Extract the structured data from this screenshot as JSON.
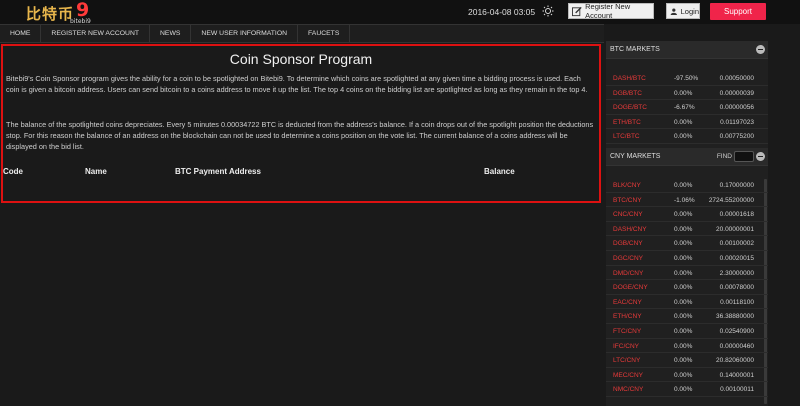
{
  "header": {
    "logo_cn": "比特币",
    "logo_9": "9",
    "logo_sub": "bitebi9",
    "datetime": "2016-04-08 03:05",
    "register_label": "Register New Account",
    "login_label": "Login",
    "support_label": "Support"
  },
  "nav": {
    "items": [
      "HOME",
      "REGISTER NEW ACCOUNT",
      "NEWS",
      "NEW USER INFORMATION",
      "FAUCETS"
    ]
  },
  "main": {
    "title": "Coin Sponsor Program",
    "p1": "Bitebi9's Coin Sponsor program gives the ability for a coin to be spotlighted on Bitebi9. To determine which coins are spotlighted at any given time a bidding process is used. Each coin is given a bitcoin address. Users can send bitcoin to a coins address to move it up the list. The top 4 coins on the bidding list are spotlighted as long as they remain in the top 4.",
    "p2": "The balance of the spotlighted coins depreciates. Every 5 minutes 0.00034722 BTC is deducted from the address's balance. If a coin drops out of the spotlight position the deductions stop. For this reason the balance of an address on the blockchain can not be used to determine a coins position on the vote list. The current balance of a coins address will be displayed on the bid list.",
    "columns": [
      "Code",
      "Name",
      "BTC Payment Address",
      "Balance"
    ]
  },
  "btc_markets": {
    "title": "BTC MARKETS",
    "rows": [
      {
        "name": "DASH/BTC",
        "change": "-97.50%",
        "price": "0.00050000"
      },
      {
        "name": "DGB/BTC",
        "change": "0.00%",
        "price": "0.00000039"
      },
      {
        "name": "DOGE/BTC",
        "change": "-6.67%",
        "price": "0.00000056"
      },
      {
        "name": "ETH/BTC",
        "change": "0.00%",
        "price": "0.01197023"
      },
      {
        "name": "LTC/BTC",
        "change": "0.00%",
        "price": "0.00775200"
      }
    ]
  },
  "cny_markets": {
    "title": "CNY MARKETS",
    "find_label": "FIND",
    "rows": [
      {
        "name": "BLK/CNY",
        "change": "0.00%",
        "price": "0.17000000"
      },
      {
        "name": "BTC/CNY",
        "change": "-1.06%",
        "price": "2724.55200000"
      },
      {
        "name": "CNC/CNY",
        "change": "0.00%",
        "price": "0.00001618"
      },
      {
        "name": "DASH/CNY",
        "change": "0.00%",
        "price": "20.00000001"
      },
      {
        "name": "DGB/CNY",
        "change": "0.00%",
        "price": "0.00100002"
      },
      {
        "name": "DGC/CNY",
        "change": "0.00%",
        "price": "0.00020015"
      },
      {
        "name": "DMD/CNY",
        "change": "0.00%",
        "price": "2.30000000"
      },
      {
        "name": "DOGE/CNY",
        "change": "0.00%",
        "price": "0.00078000"
      },
      {
        "name": "EAC/CNY",
        "change": "0.00%",
        "price": "0.00118100"
      },
      {
        "name": "ETH/CNY",
        "change": "0.00%",
        "price": "36.38880000"
      },
      {
        "name": "FTC/CNY",
        "change": "0.00%",
        "price": "0.02540900"
      },
      {
        "name": "IFC/CNY",
        "change": "0.00%",
        "price": "0.00000460"
      },
      {
        "name": "LTC/CNY",
        "change": "0.00%",
        "price": "20.82060000"
      },
      {
        "name": "MEC/CNY",
        "change": "0.00%",
        "price": "0.14000001"
      },
      {
        "name": "NMC/CNY",
        "change": "0.00%",
        "price": "0.00100011"
      }
    ]
  }
}
